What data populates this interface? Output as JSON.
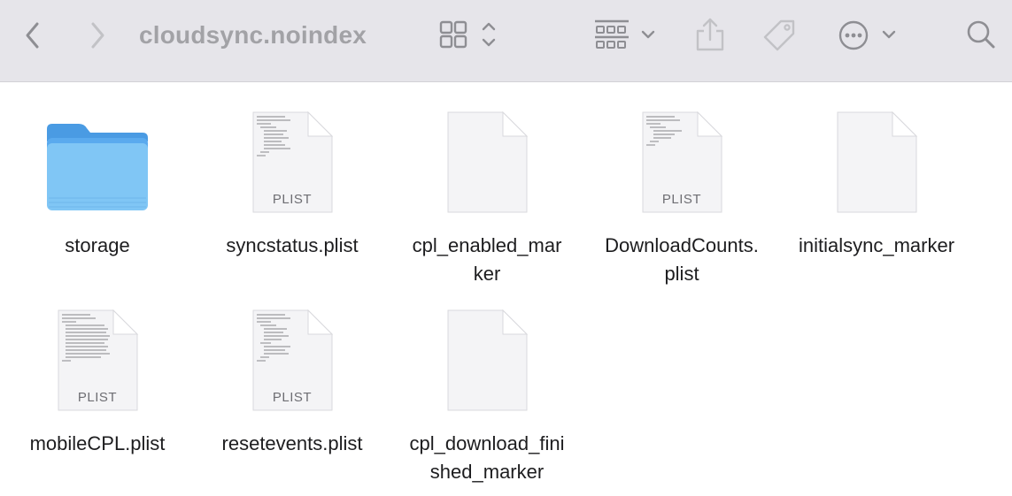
{
  "window": {
    "title": "cloudsync.noindex"
  },
  "toolbar": {
    "back_icon": "chevron-left-icon",
    "forward_icon": "chevron-right-icon",
    "view_icon": "grid-view-icon",
    "group_icon": "group-by-icon",
    "share_icon": "share-icon",
    "tag_icon": "tag-icon",
    "more_icon": "ellipsis-circle-icon",
    "search_icon": "search-icon"
  },
  "files": [
    {
      "name": "storage",
      "kind": "folder"
    },
    {
      "name": "syncstatus.plist",
      "kind": "plist",
      "badge": "PLIST"
    },
    {
      "name": "cpl_enabled_mar\nker",
      "kind": "blank"
    },
    {
      "name": "DownloadCounts.\nplist",
      "kind": "plist",
      "badge": "PLIST"
    },
    {
      "name": "initialsync_marker",
      "kind": "blank"
    },
    {
      "name": "mobileCPL.plist",
      "kind": "plist",
      "badge": "PLIST"
    },
    {
      "name": "resetevents.plist",
      "kind": "plist",
      "badge": "PLIST"
    },
    {
      "name": "cpl_download_fini\nshed_marker",
      "kind": "blank"
    }
  ],
  "colors": {
    "toolbar_bg": "#e6e5ea",
    "folder_blue": "#7cc3f3",
    "title_gray": "#a2a2a6"
  }
}
